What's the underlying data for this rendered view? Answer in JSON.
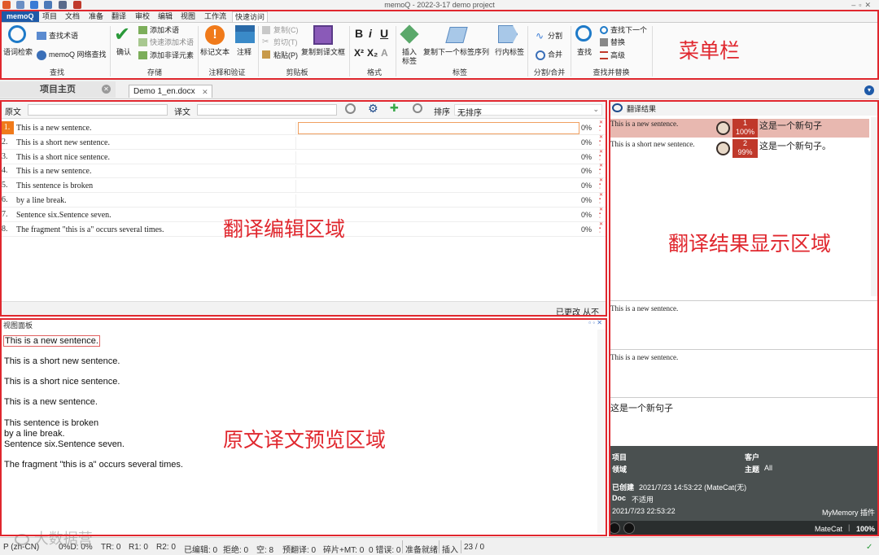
{
  "window": {
    "title": "memoQ - 2022-3-17 demo project"
  },
  "menu": {
    "tabs": [
      "memoQ",
      "项目",
      "文档",
      "准备",
      "翻译",
      "审校",
      "编辑",
      "视图",
      "工作流",
      "快速访问"
    ],
    "active": "快速访问"
  },
  "ribbon": {
    "items": {
      "term_search": "语词检索",
      "find_term": "查找术语",
      "web_search": "memoQ 网络查找",
      "confirm": "确认",
      "add_term": "添加术语",
      "quick_add_term": "快速添加术语",
      "add_nontrans": "添加非译元素",
      "mark_text": "标记文本",
      "comment": "注释",
      "copy": "复制(C)",
      "cut": "剪切(T)",
      "paste": "粘贴(P)",
      "copy_to_target": "复制到译文框",
      "insert_tag": "插入标签",
      "copy_next_tags": "复制下一个标签序列",
      "inline_tags": "行内标签",
      "split": "分割",
      "join": "合并",
      "find": "查找",
      "find_next": "查找下一个",
      "replace": "替换",
      "advanced": "高级"
    },
    "groups": {
      "find": "查找",
      "save": "存储",
      "comment_verify": "注释和验证",
      "clipboard": "剪贴板",
      "format": "格式",
      "tags": "标签",
      "split_join": "分割/合并",
      "find_replace": "查找并替换"
    }
  },
  "doc_tabs": {
    "home": "项目主页",
    "doc": "Demo 1_en.docx"
  },
  "filter": {
    "source_label": "原文",
    "target_label": "译文",
    "sort_label": "排序",
    "sort_value": "无排序"
  },
  "segments": [
    {
      "num": "1.",
      "src": "This is a new sentence.",
      "pct": "0%"
    },
    {
      "num": "2.",
      "src": "This is a short new sentence.",
      "pct": "0%"
    },
    {
      "num": "3.",
      "src": "This is a short nice sentence.",
      "pct": "0%"
    },
    {
      "num": "4.",
      "src": "This is a new sentence.",
      "pct": "0%"
    },
    {
      "num": "5.",
      "src": "This sentence is broken",
      "pct": "0%"
    },
    {
      "num": "6.",
      "src": "by a line break.",
      "pct": "0%"
    },
    {
      "num": "7.",
      "src": "Sentence six.Sentence seven.",
      "pct": "0%"
    },
    {
      "num": "8.",
      "src": "The fragment \"this is a\" occurs several times.",
      "pct": "0%"
    }
  ],
  "editor_status": {
    "changed": "已更改",
    "from": "从不"
  },
  "preview": {
    "title": "视图面板",
    "lines": [
      "This is a new sentence.",
      "This is a short new sentence.",
      "This is a short nice sentence.",
      "This is a new sentence.",
      "This sentence is broken",
      "by a line break.",
      "Sentence six.Sentence seven.",
      "The fragment \"this is a\" occurs several times."
    ]
  },
  "results": {
    "title": "翻译结果",
    "items": [
      {
        "src": "This is a new sentence.",
        "num": "1",
        "pct": "100%",
        "tgt": "这是一个新句子"
      },
      {
        "src": "This is a short new sentence.",
        "num": "2",
        "pct": "99%",
        "tgt": "这是一个新句子。"
      }
    ],
    "compare_src": "This is a new sentence.",
    "compare_src2": "This is a new sentence.",
    "compare_tgt": "这是一个新句子",
    "meta": {
      "project_k": "项目",
      "client_k": "客户",
      "domain_k": "领域",
      "subject_k": "主题",
      "subject_v": "All",
      "created_k": "已创建",
      "created_v": "2021/7/23 14:53:22 (MateCat(无)",
      "doc_k": "Doc",
      "doc_v": "不适用",
      "modified_v": "2021/7/23 22:53:22",
      "plugin": "MyMemory 插件",
      "engine": "MateCat",
      "zoom": "100%"
    }
  },
  "annotations": {
    "menu": "菜单栏",
    "editor": "翻译编辑区域",
    "results": "翻译结果显示区域",
    "preview": "原文译文预览区域"
  },
  "statusbar": [
    "P (zh-CN)",
    "0%D: 0%",
    "TR: 0",
    "R1: 0",
    "R2: 0",
    "已编辑: 0",
    "拒绝: 0",
    "空: 8",
    "预翻译: 0",
    "碎片+MT: 0",
    "0 错误: 0",
    "准备就绪",
    "插入",
    "23 / 0"
  ],
  "watermark": "大数据营"
}
